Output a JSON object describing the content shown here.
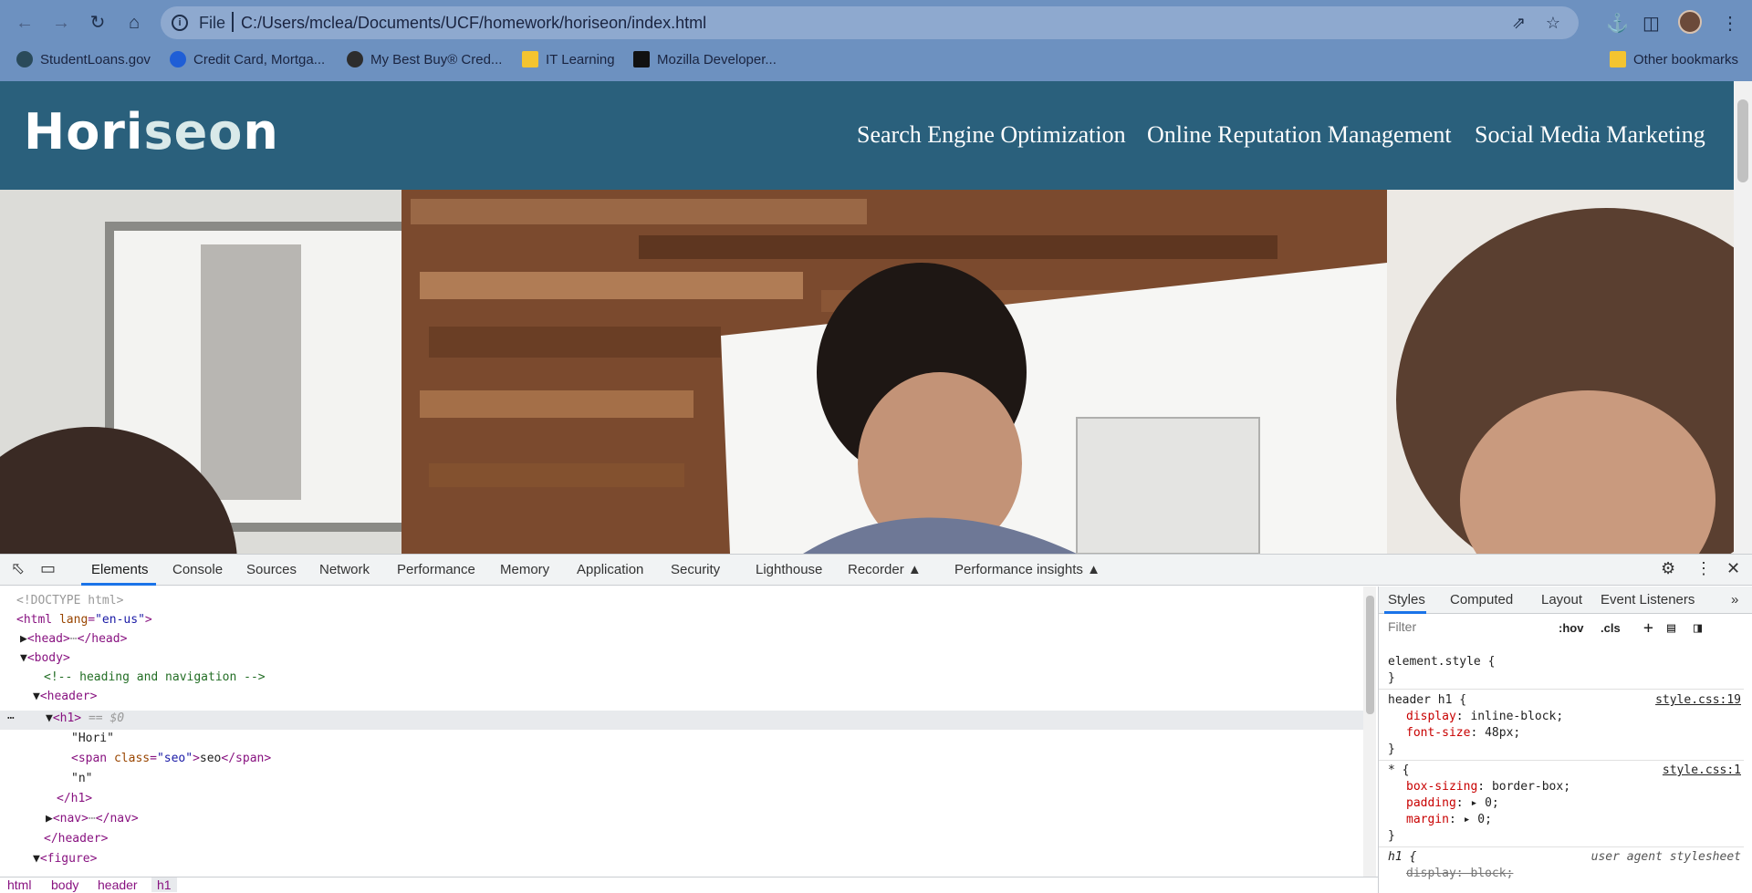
{
  "browser": {
    "omnibox_scheme": "File",
    "url": "C:/Users/mclea/Documents/UCF/homework/horiseon/index.html",
    "bookmarks": [
      {
        "label": "StudentLoans.gov"
      },
      {
        "label": "Credit Card, Mortga..."
      },
      {
        "label": "My Best Buy® Cred..."
      },
      {
        "label": "IT Learning"
      },
      {
        "label": "Mozilla Developer..."
      }
    ],
    "other_bookmarks": "Other bookmarks"
  },
  "site": {
    "brand_prefix": "Hori",
    "brand_span": "seo",
    "brand_suffix": "n",
    "nav": [
      "Search Engine Optimization",
      "Online Reputation Management",
      "Social Media Marketing"
    ]
  },
  "devtools": {
    "tabs": [
      "Elements",
      "Console",
      "Sources",
      "Network",
      "Performance",
      "Memory",
      "Application",
      "Security",
      "Lighthouse",
      "Recorder",
      "Performance insights"
    ],
    "active_tab": "Elements",
    "dom": {
      "doctype": "<!DOCTYPE html>",
      "html_open": "<html",
      "html_lang_attr": "lang",
      "html_lang_val": "\"en-us\"",
      "head_open": "<head>",
      "head_close": "</head>",
      "body_open": "<body>",
      "comment": "<!-- heading and navigation -->",
      "header_open": "<header>",
      "h1_open": "<h1>",
      "h1_marker": "== $0",
      "text_hori": "\"Hori\"",
      "span_open": "<span",
      "span_attr": "class",
      "span_val": "\"seo\"",
      "span_text": "seo",
      "span_close": "</span>",
      "text_n": "\"n\"",
      "h1_close": "</h1>",
      "nav_open": "<nav>",
      "nav_close": "</nav>",
      "header_close": "</header>",
      "figure_open": "<figure>"
    },
    "breadcrumbs": [
      "html",
      "body",
      "header",
      "h1"
    ],
    "styles_tabs": [
      "Styles",
      "Computed",
      "Layout",
      "Event Listeners"
    ],
    "filter_placeholder": "Filter",
    "hov": ":hov",
    "cls": ".cls",
    "rules": {
      "element_style": "element.style {",
      "close": "}",
      "r1_selector": "header h1 {",
      "r1_source": "style.css:19",
      "r1_p1": "display",
      "r1_v1": "inline-block;",
      "r1_p2": "font-size",
      "r1_v2": "48px;",
      "r2_selector": "* {",
      "r2_source": "style.css:1",
      "r2_p1": "box-sizing",
      "r2_v1": "border-box;",
      "r2_p2": "padding",
      "r2_v2": "0;",
      "r2_p3": "margin",
      "r2_v3": "0;",
      "r3_selector": "h1 {",
      "r3_source": "user agent stylesheet",
      "r3_p1": "display",
      "r3_v1": "block;"
    }
  },
  "colors": {
    "header_bg": "#2a607c",
    "chrome_bg": "#6d91c0",
    "devtools_accent": "#1a73e8"
  }
}
